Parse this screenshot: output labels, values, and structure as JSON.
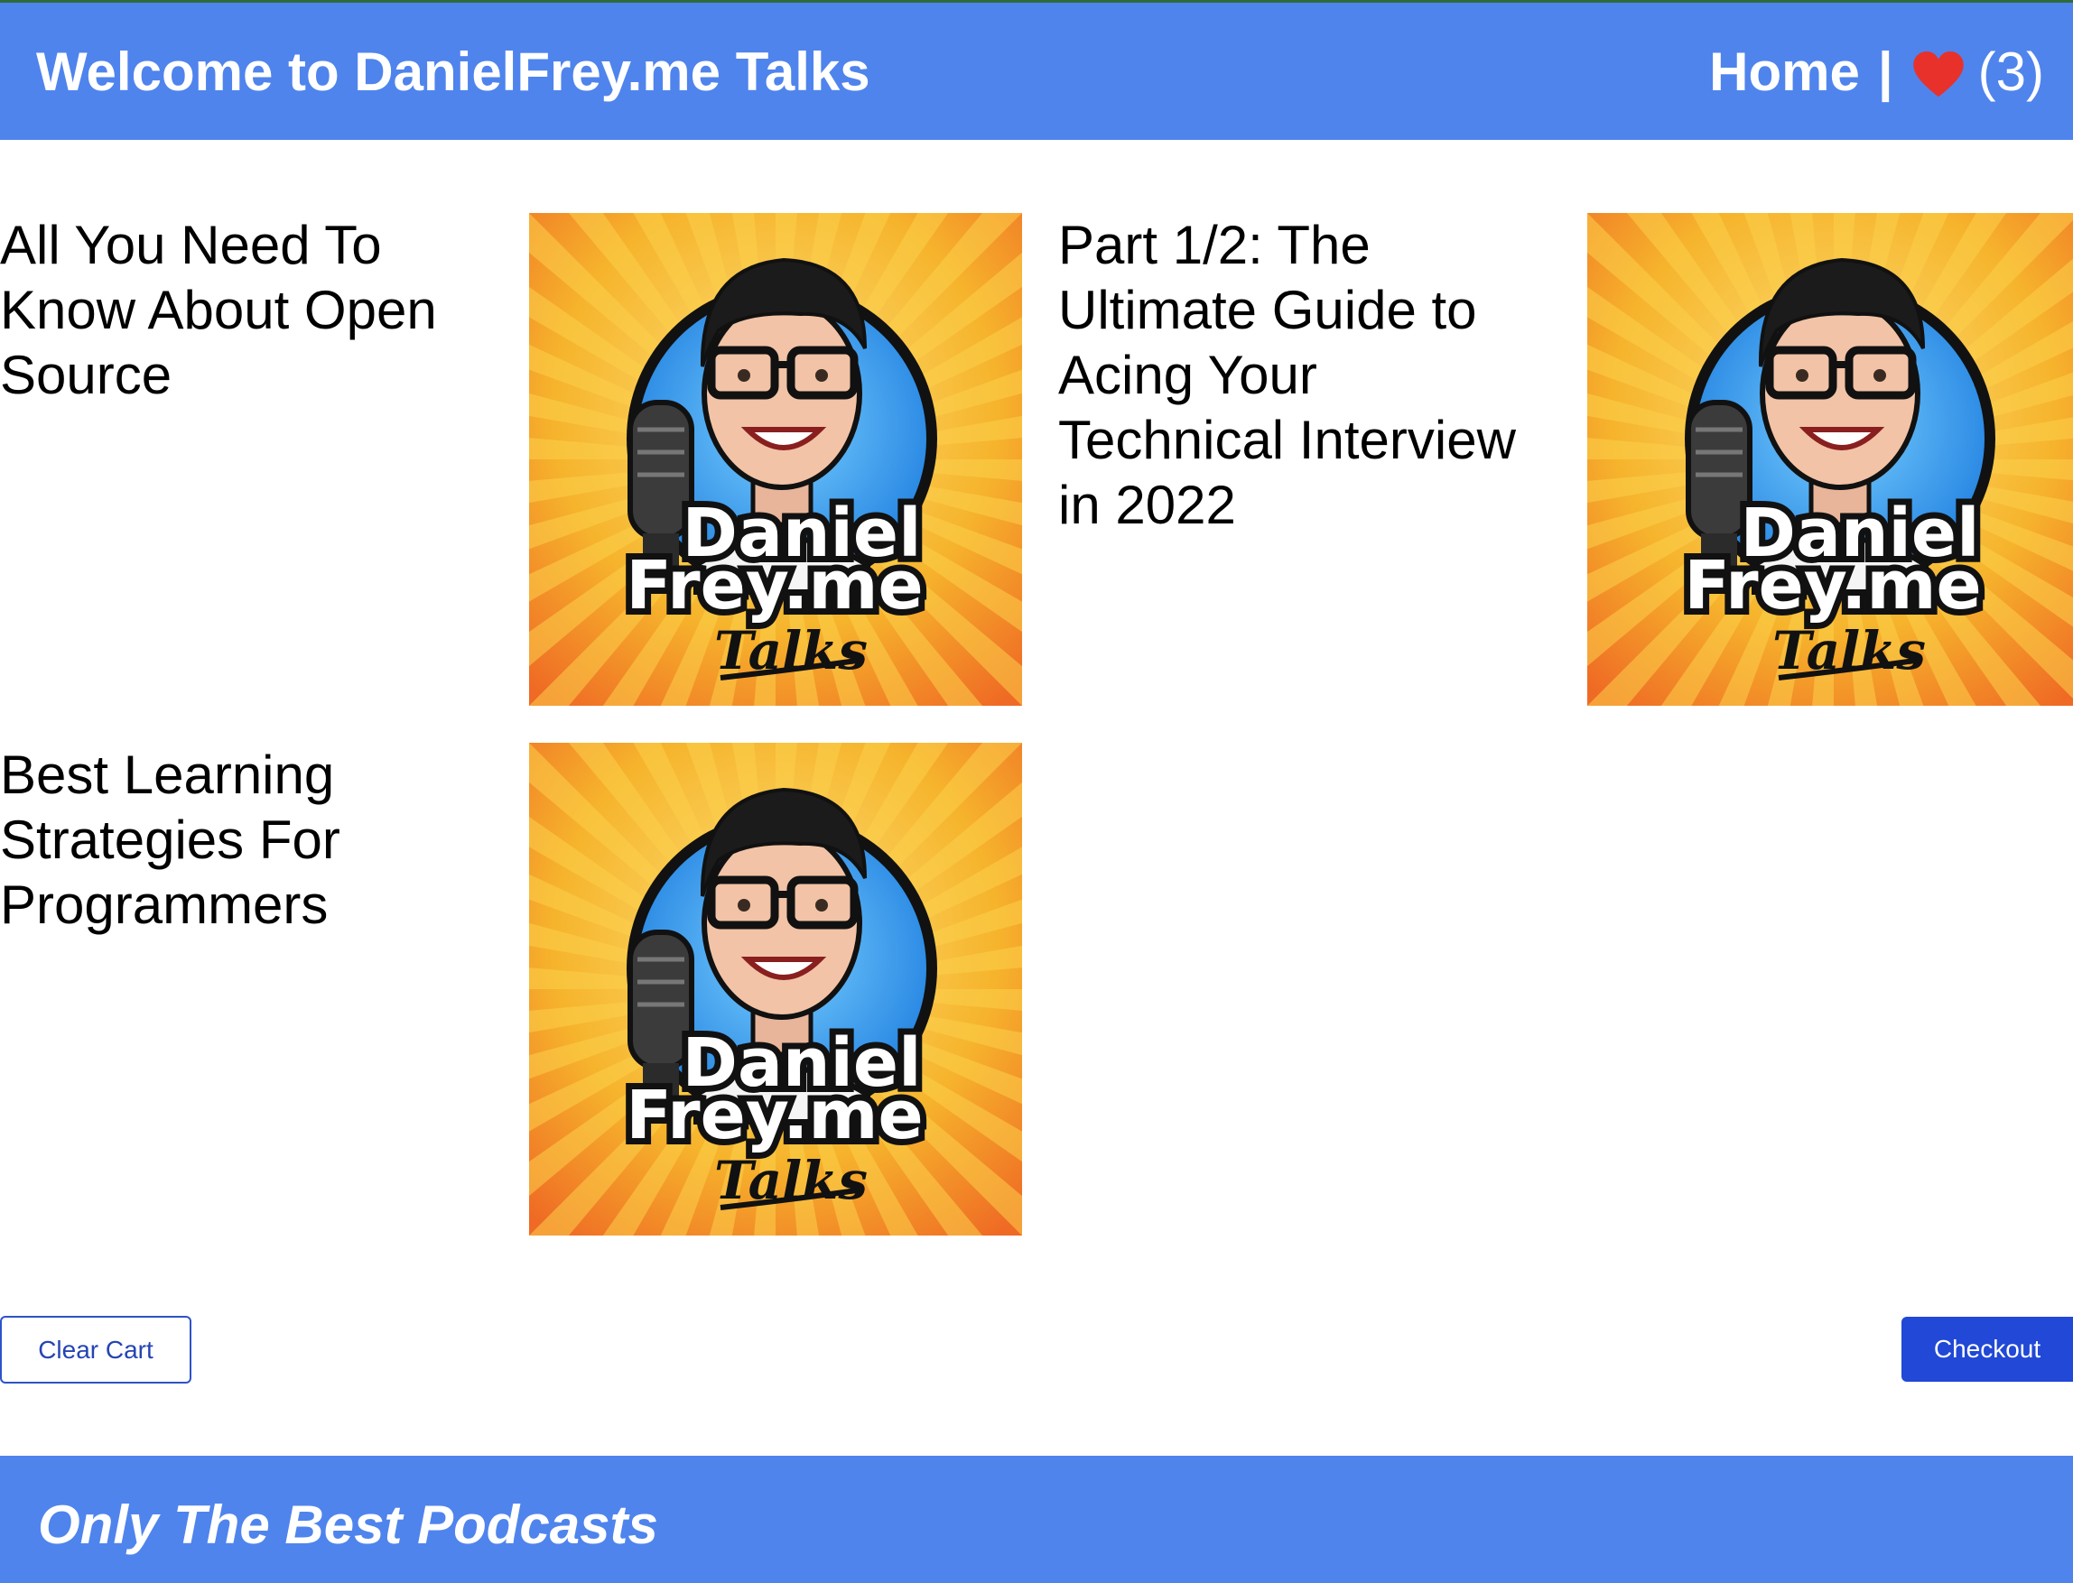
{
  "header": {
    "title": "Welcome to DanielFrey.me Talks",
    "home_label": "Home",
    "separator": "|",
    "favorites_count": "(3)"
  },
  "podcasts": [
    {
      "title": "All You Need To Know About Open Source",
      "cover_logo": {
        "line1": "Daniel",
        "line2": "Frey.me",
        "line3": "Talks"
      }
    },
    {
      "title": "Part 1/2: The Ultimate Guide to Acing Your Technical Interview in 2022",
      "cover_logo": {
        "line1": "Daniel",
        "line2": "Frey.me",
        "line3": "Talks"
      }
    },
    {
      "title": "Best Learning Strategies For Programmers",
      "cover_logo": {
        "line1": "Daniel",
        "line2": "Frey.me",
        "line3": "Talks"
      }
    }
  ],
  "actions": {
    "clear_cart": "Clear Cart",
    "checkout": "Checkout"
  },
  "footer": {
    "tagline": "Only The Best Podcasts"
  },
  "colors": {
    "header_bg": "#4f84ed",
    "heart": "#e8312a",
    "checkout_bg": "#2148d6",
    "cover_bg": "#f6b42c"
  },
  "icons": {
    "favorites": "heart-icon",
    "cover": "podcast-cover-art"
  }
}
